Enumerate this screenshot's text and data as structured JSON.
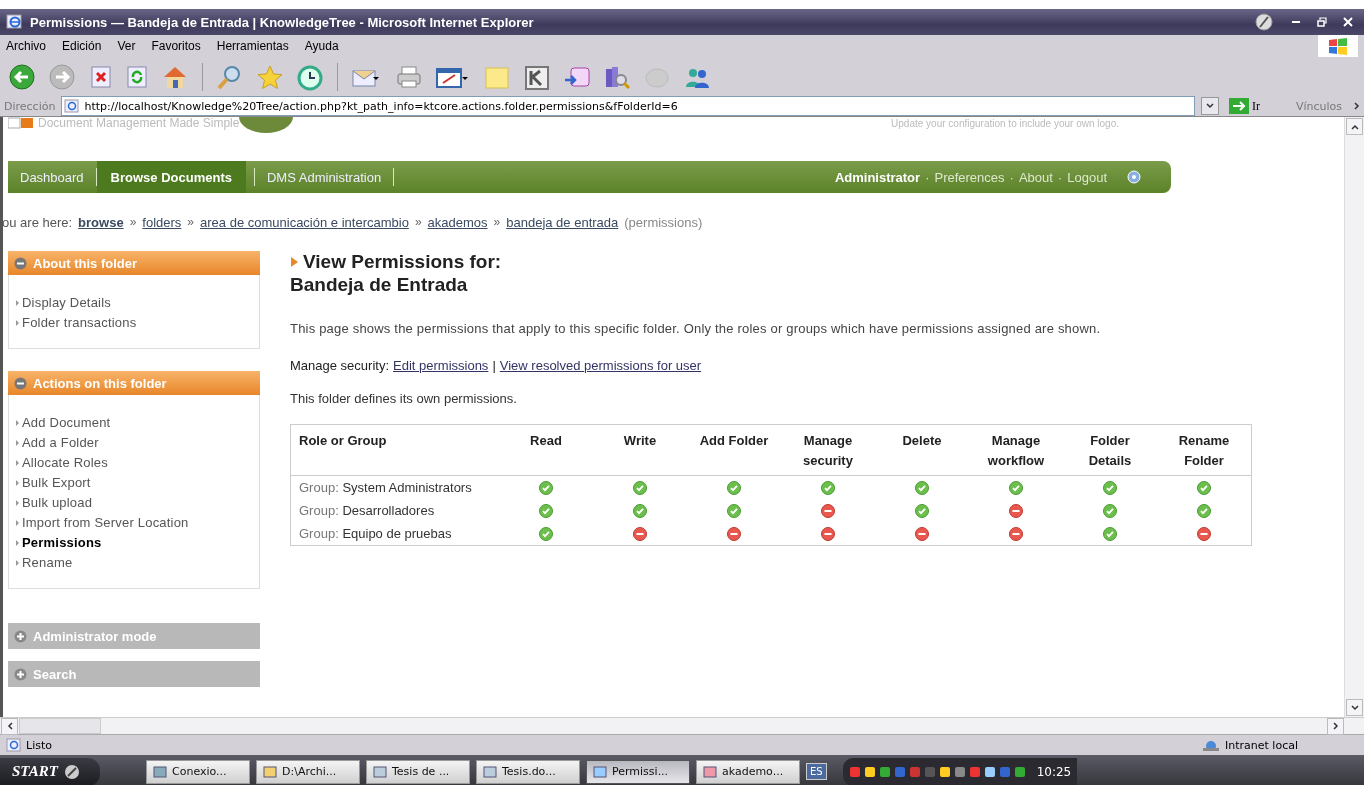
{
  "window": {
    "title": "Permissions — Bandeja de Entrada | KnowledgeTree - Microsoft Internet Explorer"
  },
  "menu": [
    "Archivo",
    "Edición",
    "Ver",
    "Favoritos",
    "Herramientas",
    "Ayuda"
  ],
  "address": {
    "label": "Dirección",
    "url": "http://localhost/Knowledge%20Tree/action.php?kt_path_info=ktcore.actions.folder.permissions&fFolderId=6",
    "go": "Ir",
    "links": "Vínculos"
  },
  "header": {
    "tagline": "Document Management Made Simple",
    "logo_hint": "Update your configuration to include your own logo."
  },
  "nav": {
    "tabs": [
      {
        "label": "Dashboard",
        "selected": false
      },
      {
        "label": "Browse Documents",
        "selected": true
      },
      {
        "label": "DMS Administration",
        "selected": false
      }
    ],
    "user": "Administrator",
    "separator": "·",
    "links": [
      "Preferences",
      "About",
      "Logout"
    ]
  },
  "breadcrumb": {
    "prefix": "ou are here:",
    "separator": "»",
    "items": [
      "browse",
      "folders",
      "area de comunicación e intercambio",
      "akademos",
      "bandeja de entrada"
    ],
    "suffix": "(permissions)"
  },
  "sidebar": {
    "panels": [
      {
        "title": "About this folder",
        "expanded": true,
        "items": [
          {
            "label": "Display Details",
            "selected": false
          },
          {
            "label": "Folder transactions",
            "selected": false
          }
        ]
      },
      {
        "title": "Actions on this folder",
        "expanded": true,
        "items": [
          {
            "label": "Add Document",
            "selected": false
          },
          {
            "label": "Add a Folder",
            "selected": false
          },
          {
            "label": "Allocate Roles",
            "selected": false
          },
          {
            "label": "Bulk Export",
            "selected": false
          },
          {
            "label": "Bulk upload",
            "selected": false
          },
          {
            "label": "Import from Server Location",
            "selected": false
          },
          {
            "label": "Permissions",
            "selected": true
          },
          {
            "label": "Rename",
            "selected": false
          }
        ]
      },
      {
        "title": "Administrator mode",
        "expanded": false
      },
      {
        "title": "Search",
        "expanded": false
      }
    ]
  },
  "main": {
    "heading_1": "View Permissions for:",
    "heading_2": "Bandeja de Entrada",
    "intro": "This page shows the permissions that apply to this specific folder. Only the roles or groups which have permissions assigned are shown.",
    "manage_label": "Manage security:",
    "manage_separator": "|",
    "manage_links": [
      "Edit permissions",
      "View resolved permissions for user"
    ],
    "note": "This folder defines its own permissions.",
    "table": {
      "columns": [
        "Role or Group",
        "Read",
        "Write",
        "Add Folder",
        "Manage security",
        "Delete",
        "Manage workflow",
        "Folder Details",
        "Rename Folder"
      ],
      "rows": [
        {
          "prefix": "Group:",
          "name": "System Administrators",
          "permissions": [
            true,
            true,
            true,
            true,
            true,
            true,
            true,
            true
          ]
        },
        {
          "prefix": "Group:",
          "name": "Desarrolladores",
          "permissions": [
            true,
            true,
            true,
            false,
            true,
            false,
            true,
            true
          ]
        },
        {
          "prefix": "Group:",
          "name": "Equipo de pruebas",
          "permissions": [
            true,
            false,
            false,
            false,
            false,
            false,
            true,
            false
          ]
        }
      ]
    }
  },
  "status_bar": {
    "text": "Listo",
    "zone": "Intranet local"
  },
  "taskbar": {
    "start": "START",
    "tasks": [
      {
        "label": "Conexio...",
        "selected": false
      },
      {
        "label": "D:\\Archi...",
        "selected": false
      },
      {
        "label": "Tesis de ...",
        "selected": false
      },
      {
        "label": "Tesis.do...",
        "selected": false
      },
      {
        "label": "Permissi...",
        "selected": true
      },
      {
        "label": "akademo...",
        "selected": false
      }
    ],
    "language": "ES",
    "clock": "10:25"
  }
}
